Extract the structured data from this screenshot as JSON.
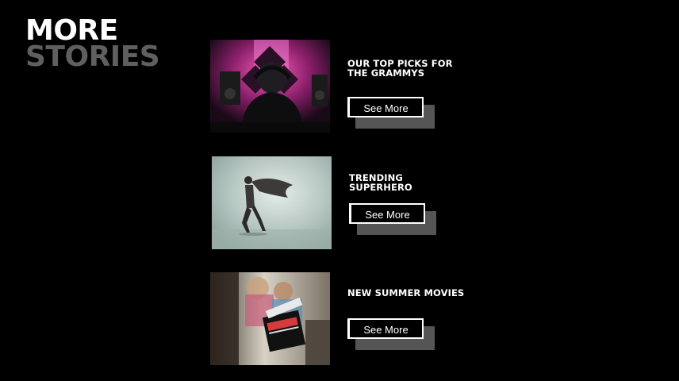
{
  "header": {
    "title_line1": "MORE",
    "title_line2": "STORIES"
  },
  "colors": {
    "background": "#000000",
    "title_primary": "#ffffff",
    "title_secondary": "#5f5f5f",
    "button_shadow": "#555555"
  },
  "stories": [
    {
      "title": "OUR TOP PICKS FOR THE GRAMMYS",
      "image_subject": "person with headphones in front of pink lit studio monitors",
      "button_label": "See More"
    },
    {
      "title": "TRENDING SUPERHERO",
      "image_subject": "caped figure in a misty room",
      "button_label": "See More"
    },
    {
      "title": "NEW SUMMER MOVIES",
      "image_subject": "film clapperboard on a movie set",
      "button_label": "See More"
    }
  ]
}
